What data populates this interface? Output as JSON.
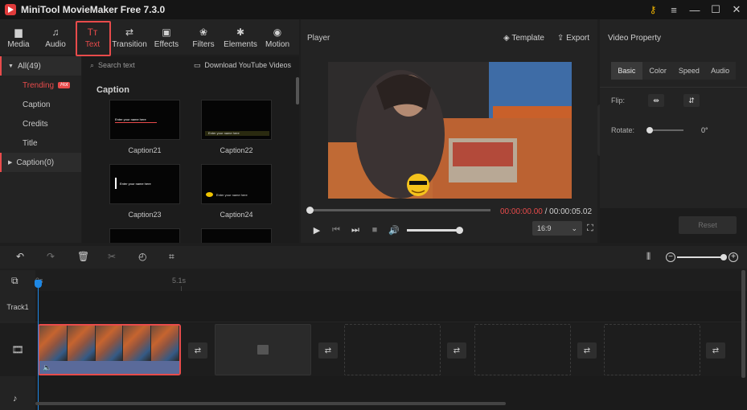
{
  "app": {
    "title": "MiniTool MovieMaker Free 7.3.0"
  },
  "toolbar": {
    "items": [
      {
        "label": "Media",
        "icon": "media-icon"
      },
      {
        "label": "Audio",
        "icon": "music-note-icon"
      },
      {
        "label": "Text",
        "icon": "text-tt-icon",
        "active": true
      },
      {
        "label": "Transition",
        "icon": "transition-icon"
      },
      {
        "label": "Effects",
        "icon": "effects-icon"
      },
      {
        "label": "Filters",
        "icon": "filters-icon"
      },
      {
        "label": "Elements",
        "icon": "elements-icon"
      },
      {
        "label": "Motion",
        "icon": "motion-icon"
      }
    ]
  },
  "categories": {
    "all": "All(49)",
    "trending": "Trending",
    "hot": "Hot",
    "caption": "Caption",
    "credits": "Credits",
    "title": "Title",
    "caption_group": "Caption(0)"
  },
  "content": {
    "search_placeholder": "Search text",
    "youtube": "Download YouTube Videos",
    "section_title": "Caption",
    "cards": [
      "Caption21",
      "Caption22",
      "Caption23",
      "Caption24"
    ],
    "thumb_text": "Enter your name here"
  },
  "player": {
    "title": "Player",
    "template": "Template",
    "export": "Export",
    "current_time": "00:00:00.00",
    "separator": " / ",
    "total_time": "00:00:05.02",
    "aspect_ratio": "16:9"
  },
  "property": {
    "title": "Video Property",
    "tabs": [
      "Basic",
      "Color",
      "Speed",
      "Audio"
    ],
    "flip_label": "Flip:",
    "rotate_label": "Rotate:",
    "rotate_value": "0°",
    "reset": "Reset"
  },
  "timeline": {
    "ruler_start": "0s",
    "ruler_mark": "5.1s",
    "track1": "Track1"
  },
  "colors": {
    "accent": "#e84b4b",
    "playhead": "#1e88e5"
  }
}
